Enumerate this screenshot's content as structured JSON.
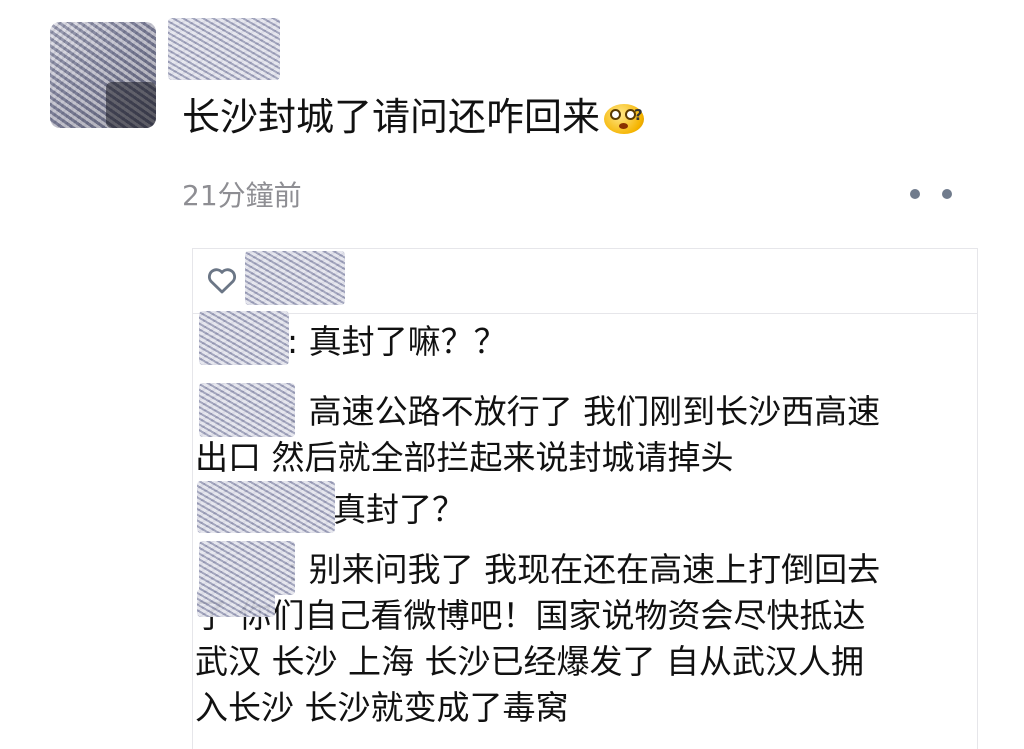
{
  "post": {
    "text": "长沙封城了请问还咋回来",
    "emoji": "dizzy-face-emoji",
    "timestamp": "21分鐘前"
  },
  "actions": {
    "more_icon": "more-dots-icon",
    "like_icon": "heart-icon"
  },
  "comments": [
    {
      "lines": [
        ": 真封了嘛？？"
      ]
    },
    {
      "lines": [
        ": 高速公路不放行了 我们刚到长沙西高速",
        "出口 然后就全部拦起来说封城请掉头"
      ]
    },
    {
      "lines": [
        " 真封了？"
      ]
    },
    {
      "lines": [
        ": 别来问我了 我现在还在高速上打倒回去",
        "了 你们自己看微博吧！国家说物资会尽快抵达",
        "武汉 长沙 上海 长沙已经爆发了 自从武汉人拥",
        "入长沙 长沙就变成了毒窝"
      ]
    }
  ],
  "colors": {
    "text": "#111111",
    "timestamp": "#8e8e93",
    "dots": "#707b8c",
    "divider": "#e6e6ea"
  }
}
